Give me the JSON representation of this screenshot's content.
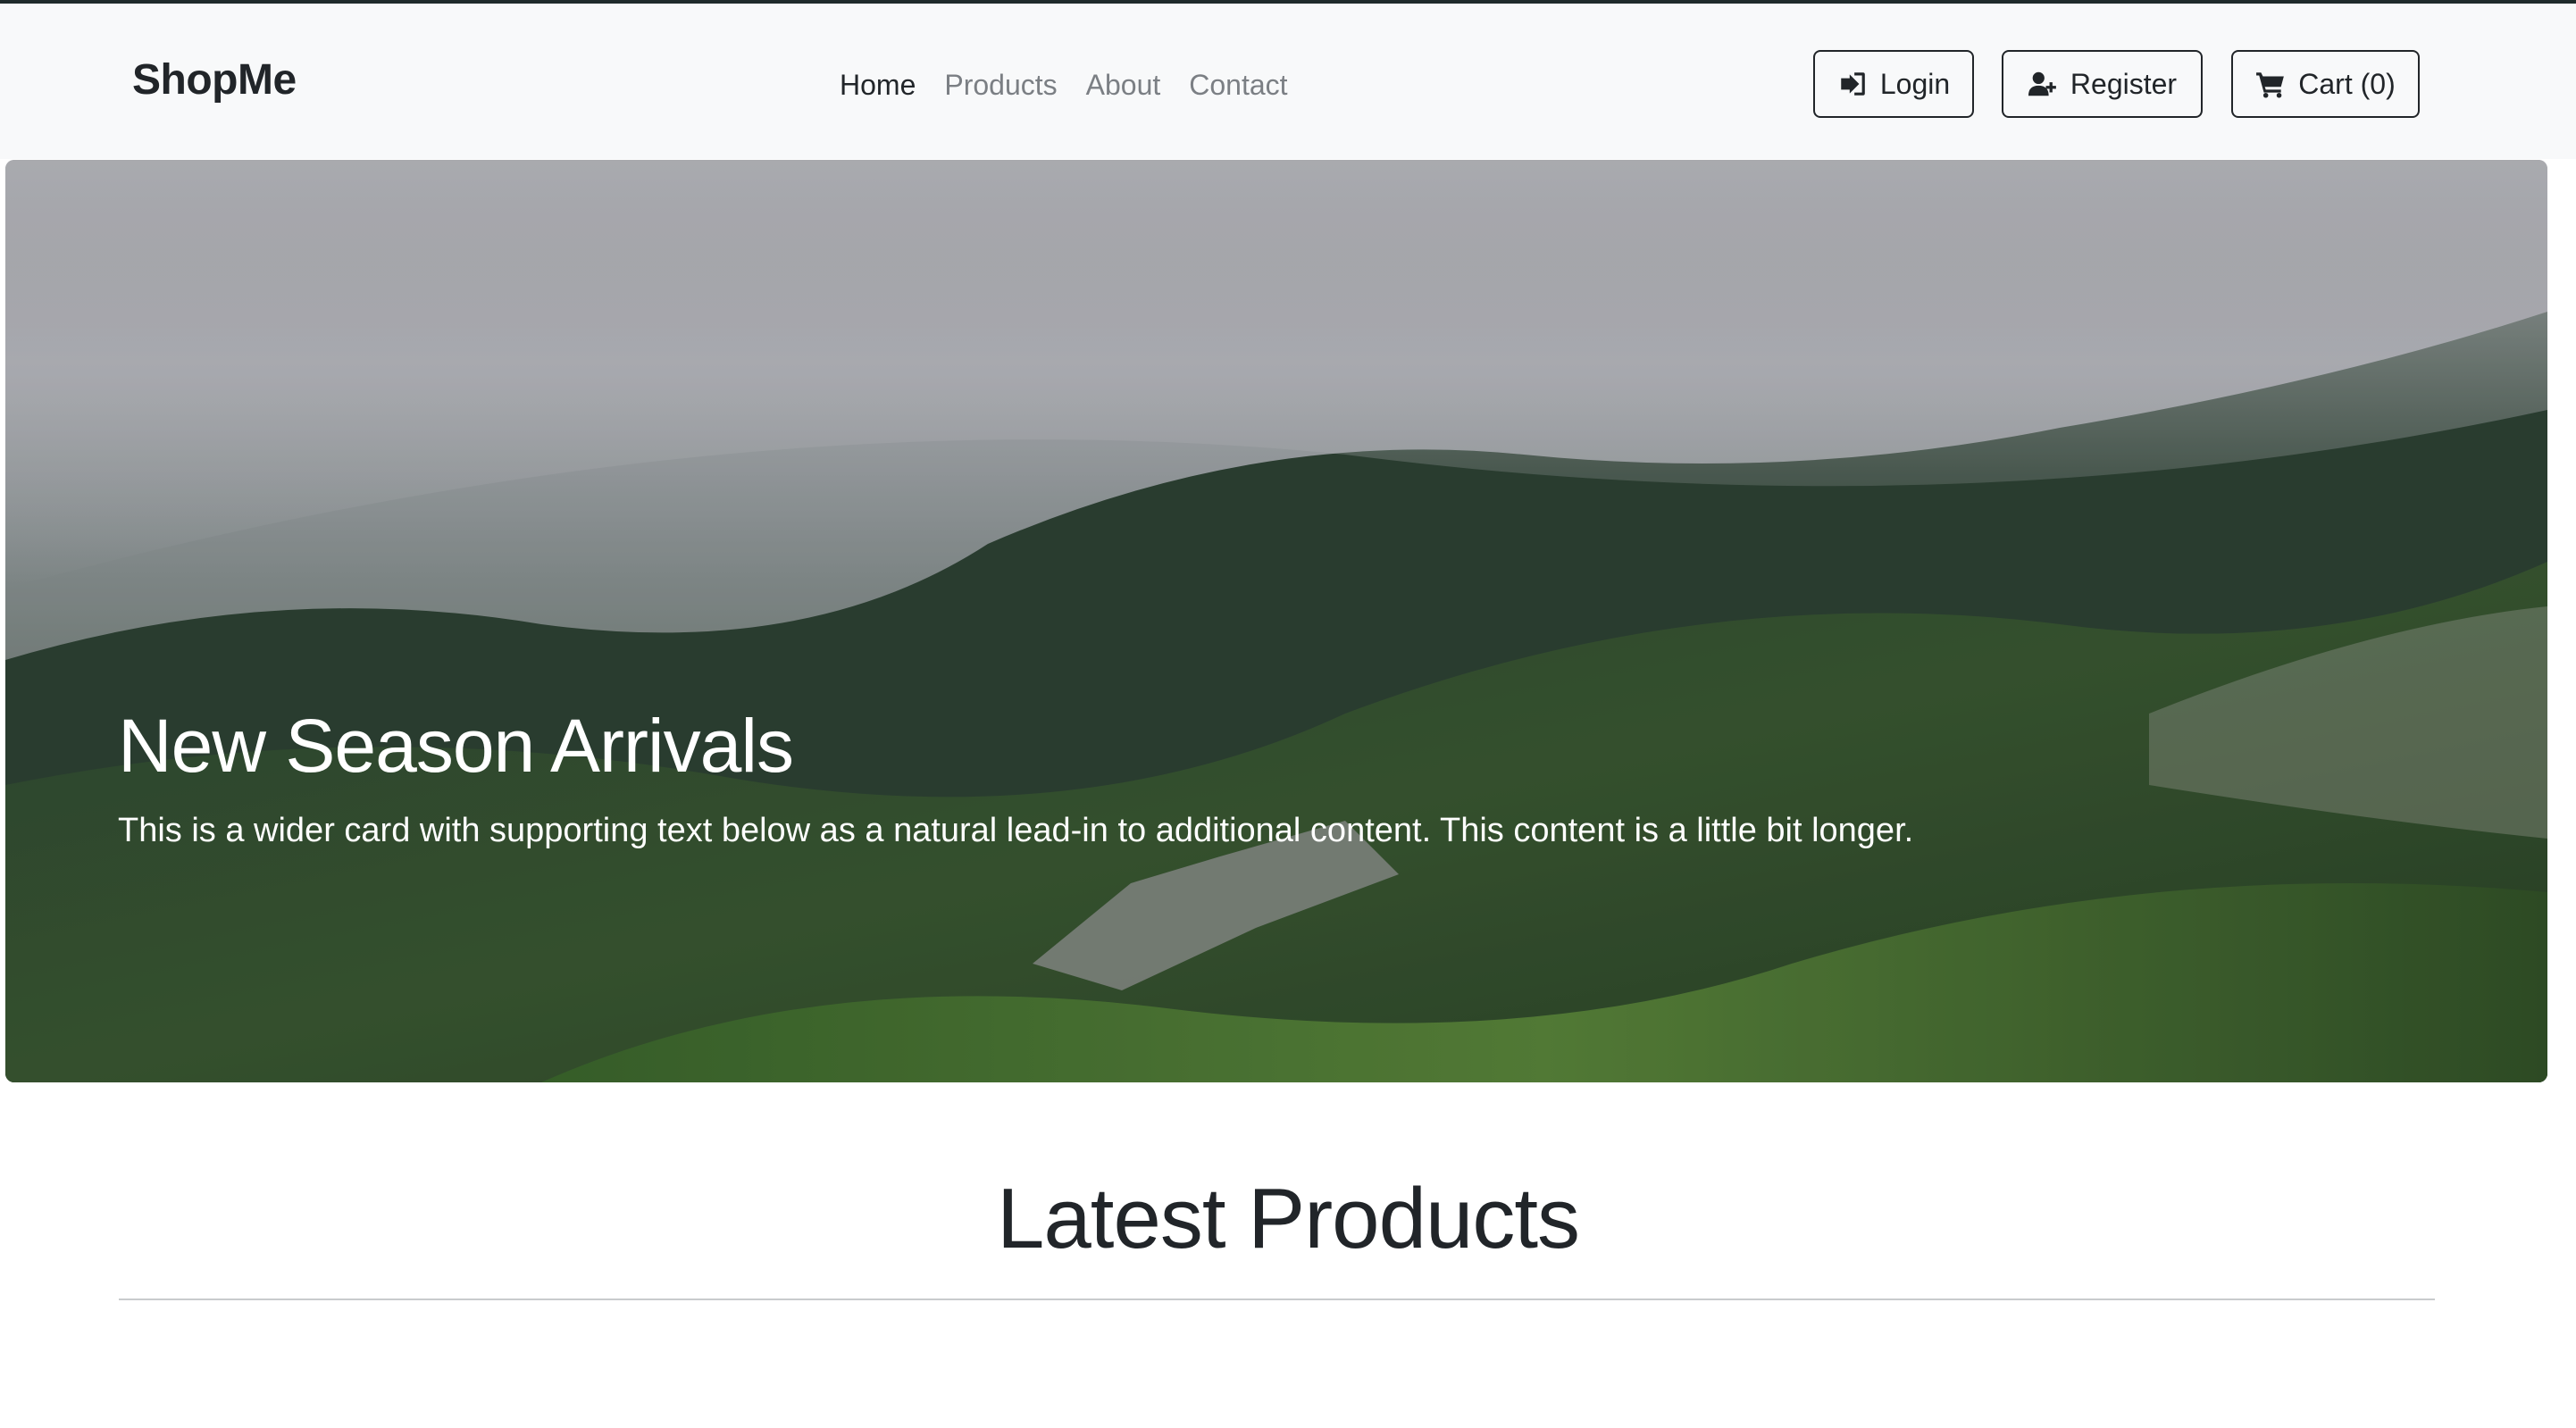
{
  "navbar": {
    "brand": "ShopMe",
    "links": [
      {
        "label": "Home",
        "active": true
      },
      {
        "label": "Products",
        "active": false
      },
      {
        "label": "About",
        "active": false
      },
      {
        "label": "Contact",
        "active": false
      }
    ],
    "buttons": {
      "login": {
        "label": "Login",
        "icon": "sign-in-icon"
      },
      "register": {
        "label": "Register",
        "icon": "user-plus-icon"
      },
      "cart": {
        "label": "Cart (0)",
        "icon": "shopping-cart-icon"
      }
    }
  },
  "hero": {
    "title": "New Season Arrivals",
    "text": "This is a wider card with supporting text below as a natural lead-in to additional content. This content is a little bit longer."
  },
  "section": {
    "title": "Latest Products"
  },
  "colors": {
    "navbar_bg": "#f8f9fa",
    "text_dark": "#212529",
    "text_muted": "#7b7f84",
    "hero_text": "#ffffff"
  }
}
